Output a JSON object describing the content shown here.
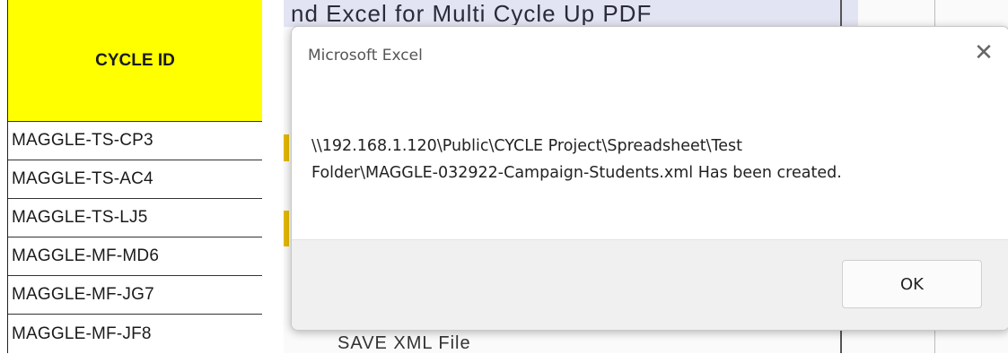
{
  "sheet": {
    "header": "CYCLE ID",
    "rows": [
      "MAGGLE-TS-CP3",
      "MAGGLE-TS-AC4",
      "MAGGLE-TS-LJ5",
      "MAGGLE-MF-MD6",
      "MAGGLE-MF-JG7",
      "MAGGLE-MF-JF8"
    ]
  },
  "background": {
    "top_fragment": "nd Excel for Multi Cycle Up PDF",
    "bottom_fragment": "SAVE XML File"
  },
  "dialog": {
    "title": "Microsoft Excel",
    "close_glyph": "✕",
    "message_line1": "\\\\192.168.1.120\\Public\\CYCLE Project\\Spreadsheet\\Test",
    "message_line2": "Folder\\MAGGLE-032922-Campaign-Students.xml Has been created.",
    "ok_label": "OK"
  },
  "colors": {
    "header_fill": "#ffff00",
    "dialog_footer": "#f0f0f0"
  }
}
